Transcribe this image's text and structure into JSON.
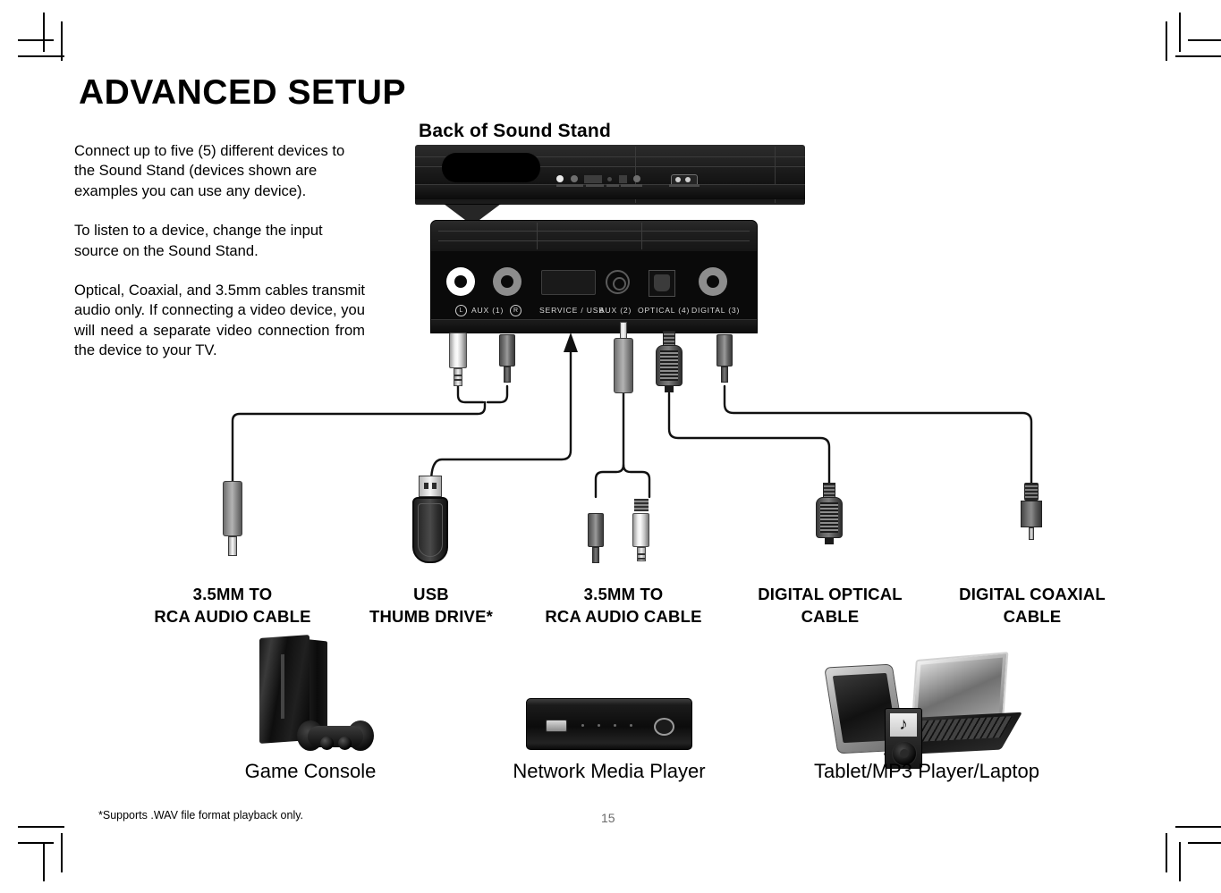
{
  "page": {
    "title": "ADVANCED SETUP",
    "section_title": "Back of Sound Stand",
    "page_number": "15",
    "footnote": "*Supports .WAV file format playback only."
  },
  "body_text": {
    "p1": "Connect up to five (5) different devices to the Sound Stand (devices shown are examples you can use any device).",
    "p2": "To listen to a device, change the input source on the Sound Stand.",
    "p3": "Optical, Coaxial, and 3.5mm cables transmit audio only. If connecting a video device, you will need a separate video connection from the device to your TV."
  },
  "sound_stand": {
    "ports": [
      {
        "label": "AUX (1)",
        "left_badge": "L",
        "right_badge": "R",
        "type": "rca-pair"
      },
      {
        "label": "SERVICE / USB",
        "type": "usb"
      },
      {
        "label": "AUX (2)",
        "type": "mini-jack"
      },
      {
        "label": "OPTICAL (4)",
        "type": "toslink"
      },
      {
        "label": "DIGITAL (3)",
        "type": "coaxial"
      }
    ]
  },
  "cables": [
    {
      "id": "cable-aux1",
      "line1": "3.5MM TO",
      "line2": "RCA AUDIO CABLE"
    },
    {
      "id": "cable-usb",
      "line1": "USB",
      "line2": "THUMB DRIVE*"
    },
    {
      "id": "cable-aux2",
      "line1": "3.5MM TO",
      "line2": "RCA AUDIO CABLE"
    },
    {
      "id": "cable-optical",
      "line1": "DIGITAL OPTICAL",
      "line2": "CABLE"
    },
    {
      "id": "cable-coaxial",
      "line1": "DIGITAL COAXIAL",
      "line2": "CABLE"
    }
  ],
  "devices": [
    {
      "id": "device-game-console",
      "label": "Game Console"
    },
    {
      "id": "device-network-media-player",
      "label": "Network Media Player"
    },
    {
      "id": "device-tablet-mp3-laptop",
      "label": "Tablet/MP3 Player/Laptop"
    }
  ],
  "mp3_glyph": "♪",
  "colors": {
    "page_background": "#ffffff",
    "text": "#000000",
    "page_number": "#6b6b6b",
    "device_body": "#0a0a0a",
    "port_label": "#d6d6d6",
    "jack_white": "#ffffff",
    "jack_grey": "#8d8d8d"
  }
}
